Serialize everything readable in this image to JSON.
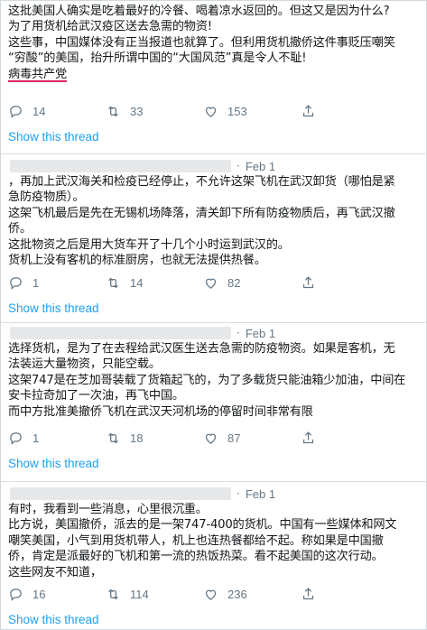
{
  "tweets": [
    {
      "date": "",
      "lines": [
        "这批美国人确实是吃着最好的冷餐、喝着凉水返回的。但这又是因为什么?",
        "为了用货机给武汉疫区送去急需的物资!",
        "这些事，中国媒体没有正当报道也就算了。但利用货机撤侨这件事贬压嘲笑",
        "“穷酸”的美国，抬升所谓中国的“大国风范”真是令人不耻!",
        "病毒共产党"
      ],
      "replies": "14",
      "retweets": "33",
      "likes": "153",
      "show_thread": "Show this thread"
    },
    {
      "date": "Feb 1",
      "lines": [
        "，再加上武汉海关和检疫已经停止，不允许这架飞机在武汉卸货（哪怕是紧",
        "急防疫物质）。",
        "这架飞机最后是先在无锡机场降落，清关卸下所有防疫物质后，再飞武汉撤",
        "侨。",
        "这批物资之后是用大货车开了十几个小时运到武汉的。",
        "货机上没有客机的标准厨房，也就无法提供热餐。"
      ],
      "replies": "1",
      "retweets": "14",
      "likes": "82",
      "show_thread": "Show this thread"
    },
    {
      "date": "Feb 1",
      "lines": [
        "选择货机，是为了在去程给武汉医生送去急需的防疫物资。如果是客机，无",
        "法装运大量物资，只能空载。",
        "这架747是在芝加哥装载了货箱起飞的，为了多载货只能油箱少加油，中间在",
        "安卡拉奇加了一次油，再飞中国。",
        "而中方批准美撤侨飞机在武汉天河机场的停留时间非常有限"
      ],
      "replies": "1",
      "retweets": "18",
      "likes": "87",
      "show_thread": "Show this thread"
    },
    {
      "date": "Feb 1",
      "lines": [
        "有时，我看到一些消息，心里很沉重。",
        "比方说，美国撤侨，派去的是一架747-400的货机。中国有一些媒体和网文",
        "嘲笑美国，小气到用货机带人，机上也连热餐都给不起。称如果是中国撤",
        "侨，肯定是派最好的飞机和第一流的热饭热菜。看不起美国的这次行动。",
        "这些网友不知道，"
      ],
      "replies": "16",
      "retweets": "114",
      "likes": "236",
      "show_thread": "Show this thread"
    }
  ],
  "icons": {
    "reply": "reply-icon",
    "retweet": "retweet-icon",
    "like": "heart-icon",
    "share": "share-icon"
  },
  "colors": {
    "link": "#1da1f2",
    "muted": "#657786",
    "text": "#14171a",
    "underline": "#e0245e"
  }
}
